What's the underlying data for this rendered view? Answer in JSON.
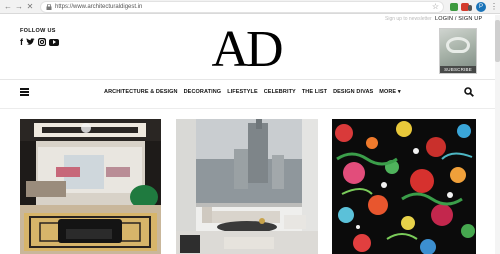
{
  "browser": {
    "url": "https://www.architecturaldigest.in",
    "back_icon": "←",
    "forward_icon": "→",
    "reload_icon": "✕",
    "star_icon": "☆",
    "profile_initial": "P",
    "menu_icon": "⋮"
  },
  "header": {
    "follow_label": "FOLLOW US",
    "social_facebook": "f",
    "newsletter_text": "Sign up to newsletter",
    "login_label": "LOGIN / SIGN UP",
    "logo_text": "AD",
    "subscribe_label": "SUBSCRIBE"
  },
  "nav": {
    "items": [
      "ARCHITECTURE & DESIGN",
      "DECORATING",
      "LIFESTYLE",
      "CELEBRITY",
      "THE LIST",
      "DESIGN DIVAS",
      "MORE"
    ],
    "more_chevron": "▾"
  },
  "colors": {
    "accent_black": "#111111",
    "chrome_bg": "#f2f2f2"
  }
}
